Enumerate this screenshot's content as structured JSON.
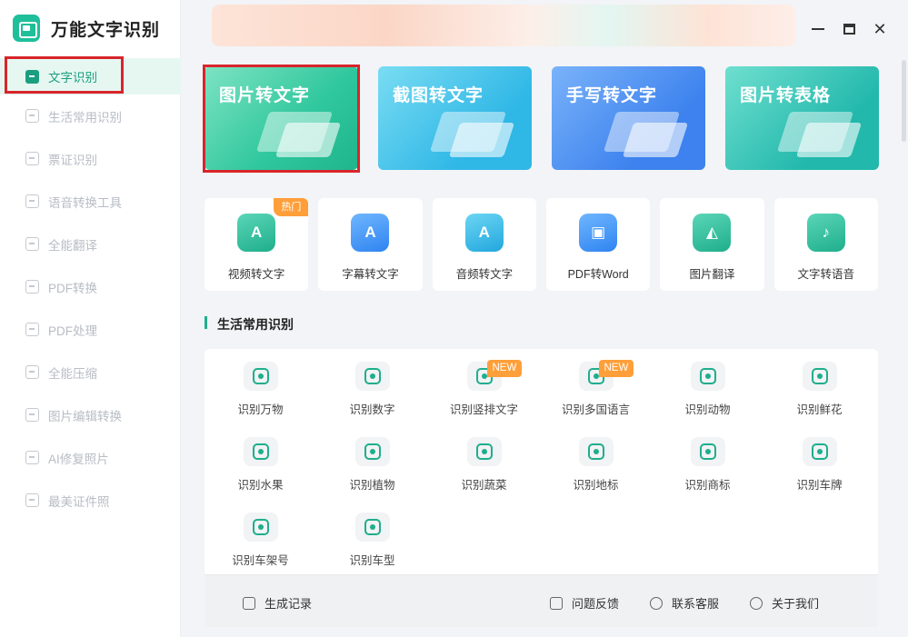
{
  "app": {
    "name": "万能文字识别"
  },
  "sidebar": {
    "items": [
      {
        "label": "文字识别",
        "active": true
      },
      {
        "label": "生活常用识别"
      },
      {
        "label": "票证识别"
      },
      {
        "label": "语音转换工具"
      },
      {
        "label": "全能翻译"
      },
      {
        "label": "PDF转换"
      },
      {
        "label": "PDF处理"
      },
      {
        "label": "全能压缩"
      },
      {
        "label": "图片编辑转换"
      },
      {
        "label": "AI修复照片"
      },
      {
        "label": "最美证件照"
      }
    ]
  },
  "window": {
    "minimize": "minimize",
    "maximize": "maximize",
    "close": "✕"
  },
  "cards": [
    {
      "title": "图片转文字"
    },
    {
      "title": "截图转文字"
    },
    {
      "title": "手写转文字"
    },
    {
      "title": "图片转表格"
    }
  ],
  "tools": [
    {
      "label": "视频转文字",
      "badge": "热门",
      "glyph": "A"
    },
    {
      "label": "字幕转文字",
      "glyph": "A"
    },
    {
      "label": "音频转文字",
      "glyph": "A"
    },
    {
      "label": "PDF转Word",
      "glyph": "▣"
    },
    {
      "label": "图片翻译",
      "glyph": "◭"
    },
    {
      "label": "文字转语音",
      "glyph": "♪"
    }
  ],
  "section": {
    "title": "生活常用识别",
    "items": [
      {
        "label": "识别万物"
      },
      {
        "label": "识别数字"
      },
      {
        "label": "识别竖排文字",
        "badge": "NEW"
      },
      {
        "label": "识别多国语言",
        "badge": "NEW"
      },
      {
        "label": "识别动物"
      },
      {
        "label": "识别鲜花"
      },
      {
        "label": "识别水果"
      },
      {
        "label": "识别植物"
      },
      {
        "label": "识别蔬菜"
      },
      {
        "label": "识别地标"
      },
      {
        "label": "识别商标"
      },
      {
        "label": "识别车牌"
      },
      {
        "label": "识别车架号"
      },
      {
        "label": "识别车型"
      }
    ]
  },
  "footer": {
    "records": "生成记录",
    "feedback": "问题反馈",
    "support": "联系客服",
    "about": "关于我们"
  },
  "colors": {
    "accent": "#1fae8c",
    "highlight": "#d8252b",
    "badge": "#ff9f3a"
  }
}
